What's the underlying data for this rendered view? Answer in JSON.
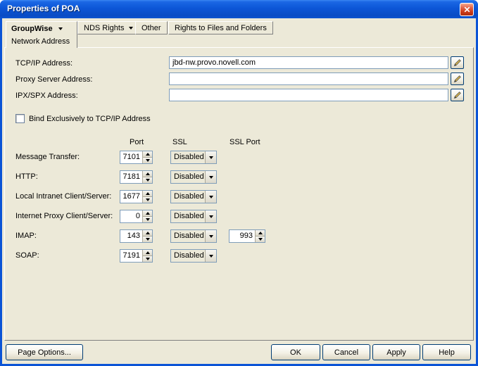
{
  "window": {
    "title": "Properties of POA"
  },
  "tabs": {
    "groupwise": "GroupWise",
    "nds_rights": "NDS Rights",
    "other": "Other",
    "rights_files_folders": "Rights to Files and Folders",
    "active_page": "Network Address"
  },
  "addresses": {
    "rows": [
      {
        "label": "TCP/IP Address:",
        "value": "jbd-nw.provo.novell.com"
      },
      {
        "label": "Proxy Server Address:",
        "value": ""
      },
      {
        "label": "IPX/SPX Address:",
        "value": ""
      }
    ]
  },
  "bind_checkbox": {
    "label": "Bind Exclusively to TCP/IP Address",
    "checked": false
  },
  "ports": {
    "headers": {
      "port": "Port",
      "ssl": "SSL",
      "ssl_port": "SSL Port"
    },
    "rows": [
      {
        "label": "Message Transfer:",
        "port": "7101",
        "ssl": "Disabled",
        "ssl_port": ""
      },
      {
        "label": "HTTP:",
        "port": "7181",
        "ssl": "Disabled",
        "ssl_port": ""
      },
      {
        "label": "Local Intranet Client/Server:",
        "port": "1677",
        "ssl": "Disabled",
        "ssl_port": ""
      },
      {
        "label": "Internet Proxy Client/Server:",
        "port": "0",
        "ssl": "Disabled",
        "ssl_port": ""
      },
      {
        "label": "IMAP:",
        "port": "143",
        "ssl": "Disabled",
        "ssl_port": "993"
      },
      {
        "label": "SOAP:",
        "port": "7191",
        "ssl": "Disabled",
        "ssl_port": ""
      }
    ]
  },
  "buttons": {
    "page_options": "Page Options...",
    "ok": "OK",
    "cancel": "Cancel",
    "apply": "Apply",
    "help": "Help"
  },
  "colors": {
    "titlebar_blue": "#0B54D6",
    "dialog_bg": "#ECE9D8",
    "field_border": "#7F9DB9",
    "button_border": "#003C74",
    "close_red": "#CB3A18"
  }
}
